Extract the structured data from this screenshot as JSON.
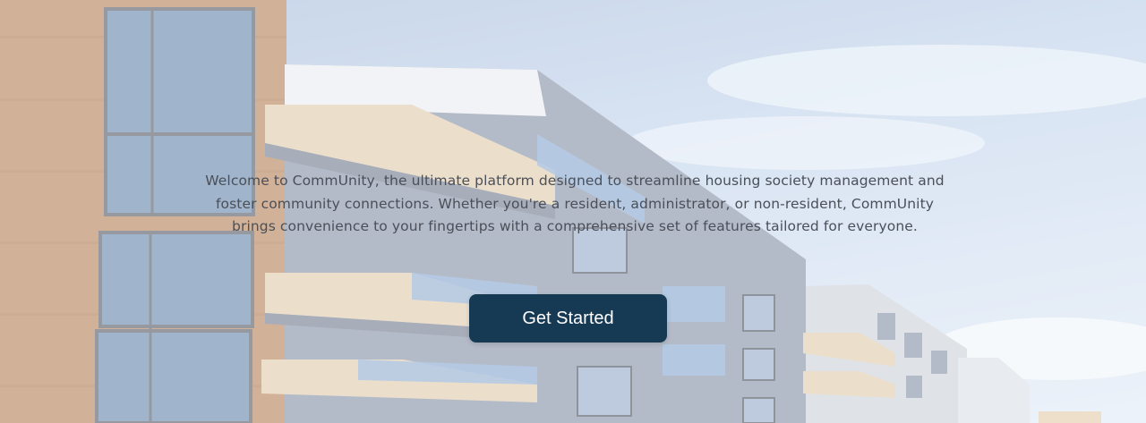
{
  "hero": {
    "intro_text": "Welcome to CommUnity, the ultimate platform designed to streamline housing society management and foster community connections. Whether you're a resident, administrator, or non-resident, CommUnity brings convenience to your fingertips with a comprehensive set of features tailored for everyone.",
    "cta_label": "Get Started",
    "background_image": "apartment-building-photo"
  },
  "colors": {
    "cta_background": "#173a54",
    "cta_text": "#ffffff",
    "body_text": "#4a4f58"
  }
}
